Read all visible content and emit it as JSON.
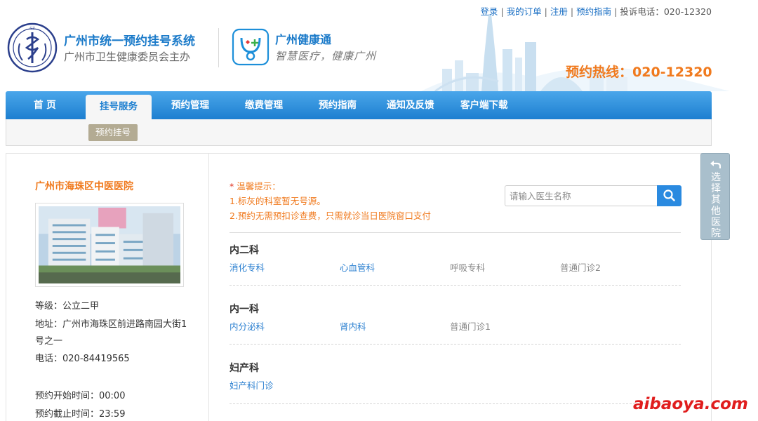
{
  "header": {
    "top_links": {
      "login": "登录",
      "my_orders": "我的订单",
      "register": "注册",
      "guide": "预约指南",
      "complaint": "投诉电话：020-12320"
    },
    "system_title": "广州市统一预约挂号系统",
    "system_subtitle": "广州市卫生健康委员会主办",
    "health_title": "广州健康通",
    "health_slogan": "智慧医疗，健康广州",
    "hotline": "预约热线：020-12320"
  },
  "nav": {
    "items": [
      {
        "label": "首 页"
      },
      {
        "label": "挂号服务"
      },
      {
        "label": "预约管理"
      },
      {
        "label": "缴费管理"
      },
      {
        "label": "预约指南"
      },
      {
        "label": "通知及反馈"
      },
      {
        "label": "客户端下载"
      }
    ],
    "active_index": 1,
    "sub_button": "预约挂号"
  },
  "hospital": {
    "name": "广州市海珠区中医医院",
    "level": "等级：公立二甲",
    "address_line1": "地址：广州市海珠区前进路南园大街1",
    "address_line2": "号之一",
    "phone": "电话：020-84419565",
    "start_time": "预约开始时间：00:00",
    "end_time": "预约截止时间：23:59"
  },
  "tips": {
    "title": "温馨提示：",
    "line1": "1.标灰的科室暂无号源。",
    "line2": "2.预约无需预扣诊查费，只需就诊当日医院窗口支付"
  },
  "search": {
    "placeholder": "请输入医生名称"
  },
  "departments": [
    {
      "name": "内二科",
      "units": [
        {
          "label": "消化专科",
          "available": true
        },
        {
          "label": "心血管科",
          "available": true
        },
        {
          "label": "呼吸专科",
          "available": false
        },
        {
          "label": "普通门诊2",
          "available": false
        }
      ]
    },
    {
      "name": "内一科",
      "units": [
        {
          "label": "内分泌科",
          "available": true
        },
        {
          "label": "肾内科",
          "available": true
        },
        {
          "label": "普通门诊1",
          "available": false
        }
      ]
    },
    {
      "name": "妇产科",
      "units": [
        {
          "label": "妇产科门诊",
          "available": true
        }
      ]
    }
  ],
  "side_tab": {
    "label": "选择其他医院"
  },
  "watermark": "aibaoya.com",
  "colors": {
    "brand_blue": "#1d7fd0",
    "accent_orange": "#f07a1e",
    "link_blue": "#2a7fd0",
    "disabled_gray": "#888888"
  }
}
